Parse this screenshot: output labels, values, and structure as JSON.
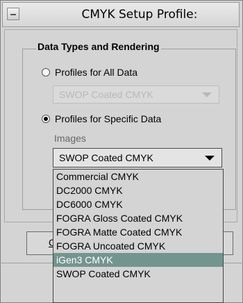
{
  "window": {
    "title": "CMYK Setup Profile:"
  },
  "group": {
    "title": "Data Types and Rendering"
  },
  "option_all": {
    "label": "Profiles for All Data",
    "checked": false,
    "combo_value": "SWOP Coated CMYK"
  },
  "option_specific": {
    "label": "Profiles for Specific Data",
    "checked": true
  },
  "images": {
    "label": "Images",
    "combo_value": "SWOP Coated CMYK"
  },
  "bottom": {
    "mnemonic_char": "C"
  },
  "dropdown": {
    "options": [
      "Commercial CMYK",
      "DC2000 CMYK",
      "DC6000 CMYK",
      "FOGRA Gloss Coated CMYK",
      "FOGRA Matte Coated CMYK",
      "FOGRA Uncoated CMYK",
      "iGen3 CMYK",
      "SWOP Coated CMYK"
    ],
    "selected_index": 6,
    "highlight_color": "#74958f"
  }
}
